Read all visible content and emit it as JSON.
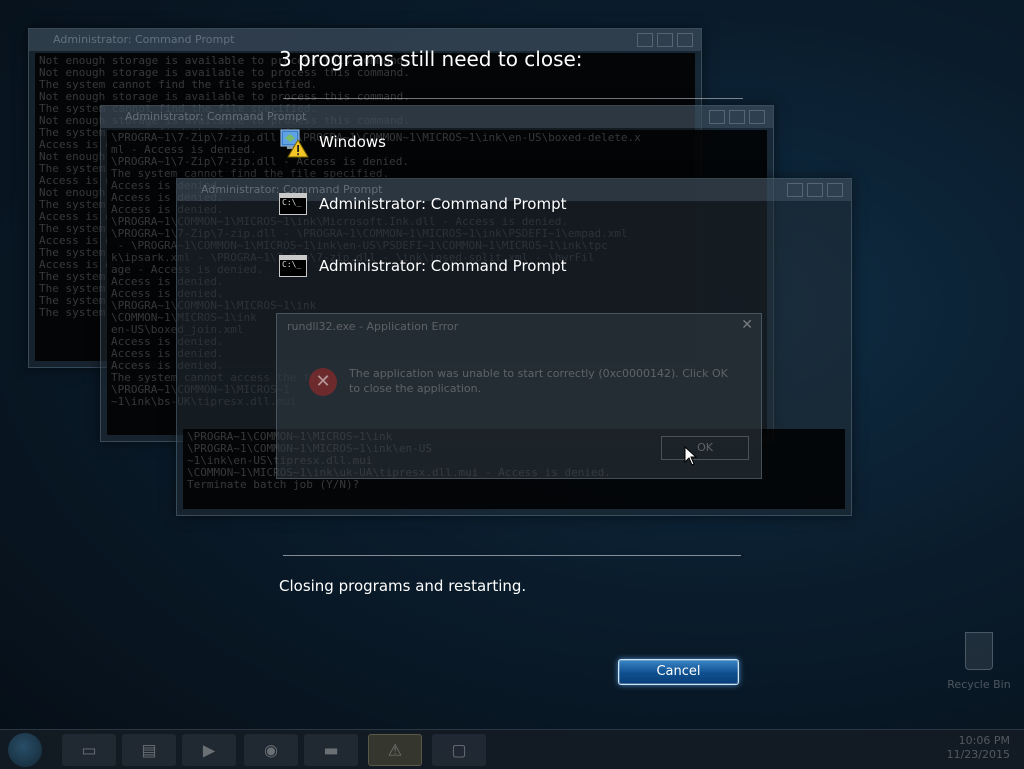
{
  "dialog": {
    "heading": "3 programs still need to close:",
    "programs": [
      {
        "label": "Windows",
        "icon": "windows-warning-icon"
      },
      {
        "label": "Administrator:  Command Prompt",
        "icon": "command-prompt-icon"
      },
      {
        "label": "Administrator:  Command Prompt",
        "icon": "command-prompt-icon"
      }
    ],
    "status": "Closing programs and restarting.",
    "cancel_label": "Cancel"
  },
  "background": {
    "cmd_window_1_title": "Administrator:  Command Prompt",
    "cmd_window_2_title": "Administrator:  Command Prompt",
    "cmd_window_3_title": "Administrator:  Command Prompt",
    "cmd_lines_1": "Not enough storage is available to process this command.\nNot enough storage is available to process this command.\nThe system cannot find the file specified.\nNot enough storage is available to process this command.\nThe system cannot find the file specified.\nNot enough storage is available to process this command.\nThe system cannot find the file specified.\nAccess is denied.\nNot enough storage is available to process this command.\nThe system cannot find the file specified.\nAccess is denied.\nNot enough storage is available.\nThe system cannot find the file specified.\nAccess is denied.\nThe system cannot find the file specified.\nAccess is denied.\nThe system cannot find the file specified.\nAccess is denied.\nThe system cannot find the file specified.\nThe system cannot find the file specified.\nThe system cannot find the file specified.\nThe system cannot find the file specified.",
    "cmd_lines_2": "\\PROGRA~1\\7-Zip\\7-zip.dll - \\PROGRA~1\\COMMON~1\\MICROS~1\\ink\\en-US\\boxed-delete.x\nml - Access is denied.\n\\PROGRA~1\\7-Zip\\7-zip.dll - Access is denied.\nThe system cannot find the file specified.\nAccess is denied.\nAccess is denied.\nAccess is denied.\n\\PROGRA~1\\COMMON~1\\MICROS~1\\ink\\Microsoft.Ink.dll - Access is denied.\n\\PROGRA~1\\7-Zip\\7-zip.dll - \\PROGRA~1\\COMMON~1\\MICROS~1\\ink\\PSDEFI~1\\empad.xml\n - \\PROGRA~1\\COMMON~1\\MICROS~1\\ink\\en-US\\PSDEFI~1\\COMMON~1\\MICROS~1\\ink\\tpc\nk\\ipsark.xml - \\PROGRA~1\\7-Zip\\7-zip.dll - \\ink\\ipsed-split.xml - \\hwrFil\nage - Access is denied.\nAccess is denied.\nAccess is denied.\n\\PROGRA~1\\COMMON~1\\MICROS~1\\ink\n\\COMMON~1\\MICROS~1\\ink\nen-US\\boxed_join.xml\nAccess is denied.\nAccess is denied.\nAccess is denied.\nThe system cannot access the file\n\\PROGRA~1\\COMMON~1\\MICROS~1\n~1\\ink\\bs-UK\\tipresx.dll.mui",
    "cmd_lines_3": "\\PROGRA~1\\COMMON~1\\MICROS~1\\ink\n\\PROGRA~1\\COMMON~1\\MICROS~1\\ink\\en-US\n~1\\ink\\en-US\\tipresx.dll.mui\n\\COMMON~1\\MICROS~1\\ink\\uk-UA\\tipresx.dll.mui - Access is denied.\nTerminate batch job (Y/N)?",
    "error_dialog": {
      "title": "rundll32.exe - Application Error",
      "message": "The application was unable to start correctly (0xc0000142). Click OK to close the application.",
      "ok_label": "OK",
      "close_glyph": "✕"
    },
    "recycle_bin_label": "Recycle Bin",
    "tray_time": "10:06 PM",
    "tray_date": "11/23/2015"
  },
  "colors": {
    "cancel_button": "#1f62a6",
    "cancel_glow": "#5aaaf0",
    "background": "#0a1c2c"
  }
}
